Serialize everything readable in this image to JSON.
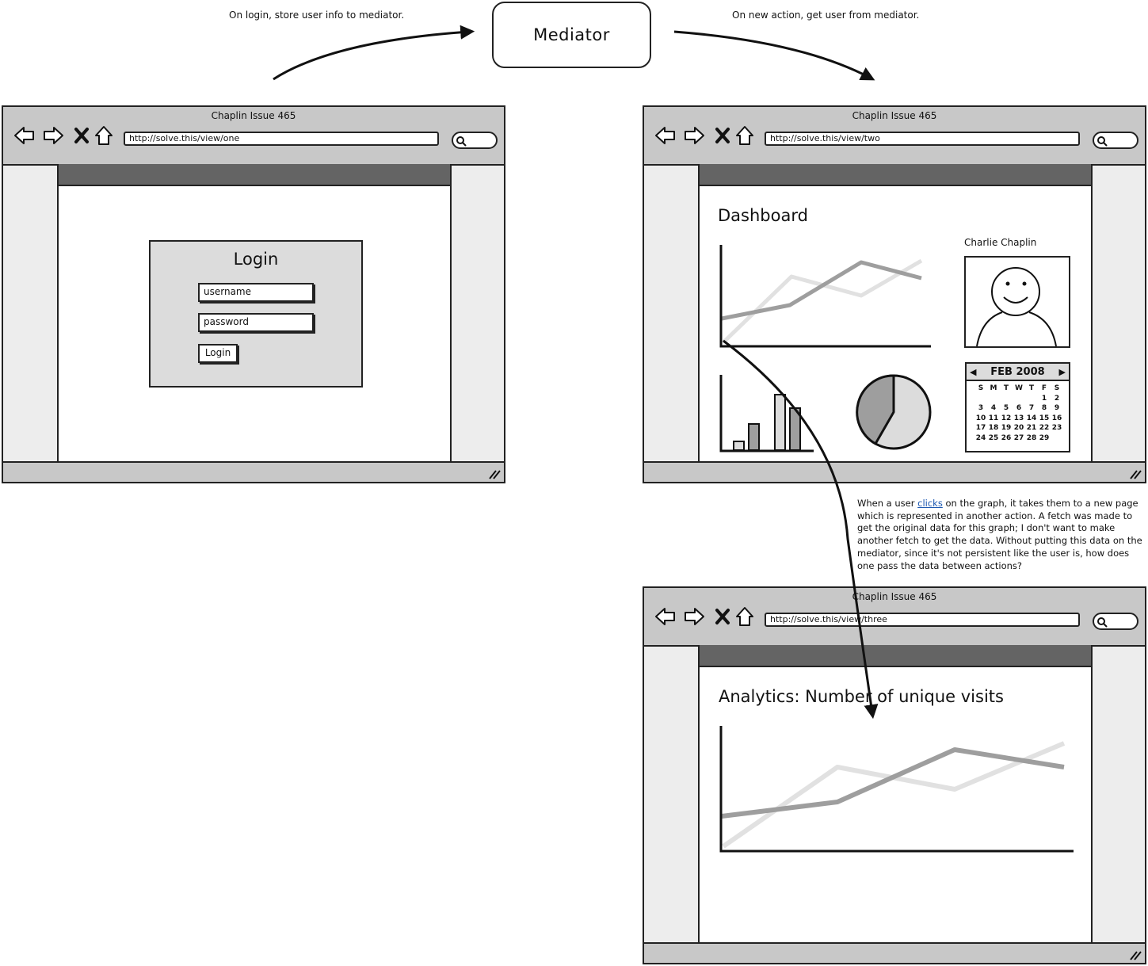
{
  "captions": {
    "left": "On login, store user info to mediator.",
    "right": "On new action, get user from mediator."
  },
  "mediator": {
    "label": "Mediator"
  },
  "browsers": [
    {
      "title": "Chaplin Issue 465",
      "url": "http://solve.this/view/one"
    },
    {
      "title": "Chaplin Issue 465",
      "url": "http://solve.this/view/two"
    },
    {
      "title": "Chaplin Issue 465",
      "url": "http://solve.this/view/three"
    }
  ],
  "login": {
    "title": "Login",
    "username_placeholder": "username",
    "password_placeholder": "password",
    "button_label": "Login"
  },
  "dashboard": {
    "title": "Dashboard",
    "user_name": "Charlie Chaplin",
    "calendar": {
      "month": "FEB 2008",
      "weekdays": [
        "S",
        "M",
        "T",
        "W",
        "T",
        "F",
        "S"
      ],
      "weeks": [
        [
          "",
          "",
          "",
          "",
          "",
          "1",
          "2"
        ],
        [
          "3",
          "4",
          "5",
          "6",
          "7",
          "8",
          "9"
        ],
        [
          "10",
          "11",
          "12",
          "13",
          "14",
          "15",
          "16"
        ],
        [
          "17",
          "18",
          "19",
          "20",
          "21",
          "22",
          "23"
        ],
        [
          "24",
          "25",
          "26",
          "27",
          "28",
          "29",
          ""
        ]
      ]
    }
  },
  "note": {
    "before_link": "When a user ",
    "link": "clicks",
    "after_link": " on the graph, it takes them to a new page which is represented in another action. A fetch was made to get the original data for this graph; I don't want to make another fetch to get the data. Without putting this data on the mediator, since it's not persistent like the user is, how does one pass the data between actions?"
  },
  "analytics": {
    "title": "Analytics: Number of unique visits"
  },
  "icons": [
    "back-icon",
    "forward-icon",
    "stop-icon",
    "home-icon",
    "search-icon",
    "resize-grip-icon",
    "smiley-avatar-icon"
  ],
  "colors": {
    "page_header": "#646464",
    "chrome": "#c8c8c8",
    "panel": "#dcdcdc",
    "sidebar": "#ededed",
    "link": "#1a56b0"
  }
}
